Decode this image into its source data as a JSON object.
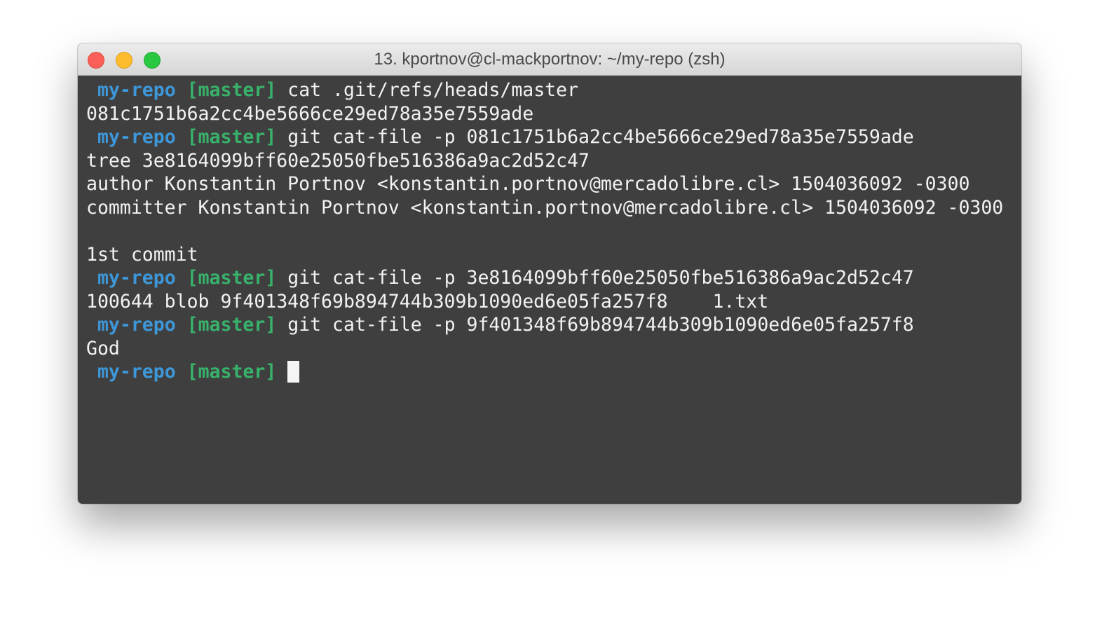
{
  "window": {
    "title": "13. kportnov@cl-mackportnov: ~/my-repo (zsh)"
  },
  "terminal": {
    "prompt_dir": "my-repo",
    "prompt_branch": "[master]",
    "commands": {
      "c1": "cat .git/refs/heads/master",
      "c2": "git cat-file -p 081c1751b6a2cc4be5666ce29ed78a35e7559ade",
      "c3": "git cat-file -p 3e8164099bff60e25050fbe516386a9ac2d52c47",
      "c4": "git cat-file -p 9f401348f69b894744b309b1090ed6e05fa257f8"
    },
    "outputs": {
      "o1": "081c1751b6a2cc4be5666ce29ed78a35e7559ade",
      "o2_tree": "tree 3e8164099bff60e25050fbe516386a9ac2d52c47",
      "o2_author": "author Konstantin Portnov <konstantin.portnov@mercadolibre.cl> 1504036092 -0300",
      "o2_committer": "committer Konstantin Portnov <konstantin.portnov@mercadolibre.cl> 1504036092 -0300",
      "o2_message": "1st commit",
      "o3": "100644 blob 9f401348f69b894744b309b1090ed6e05fa257f8    1.txt",
      "o4": "God"
    }
  },
  "colors": {
    "prompt_dir": "#3d97d8",
    "prompt_branch": "#38b26b",
    "terminal_bg": "#3f3f3f",
    "text": "#f2f2f2"
  }
}
